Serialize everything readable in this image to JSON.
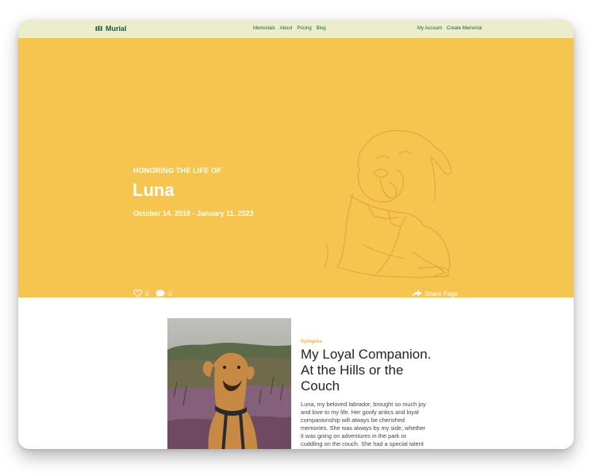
{
  "nav": {
    "brand": "Murial",
    "links": [
      "Memorials",
      "About",
      "Pricing",
      "Blog"
    ],
    "account": [
      "My Account",
      "Create Memorial"
    ]
  },
  "hero": {
    "eyebrow": "HONORING THE LIFE OF",
    "name": "Luna",
    "dates": "October 14, 2010 - January 11, 2023",
    "likes": "0",
    "comments": "0",
    "share_label": "Share Page",
    "background_color": "#f5c550"
  },
  "story": {
    "section_label": "Synopsis",
    "title": "My Loyal Companion. At the Hills or the Couch",
    "body": "Luna, my beloved labrador, brought so much joy and love to my life. Her goofy antics and loyal companionship will always be cherished memories. She was always by my side, whether it was going on adventures in the park or cuddling on the couch. She had a special talent for making"
  },
  "colors": {
    "brand_green": "#1f5a45",
    "nav_bg": "#ecedcc",
    "accent": "#f2b32b"
  }
}
